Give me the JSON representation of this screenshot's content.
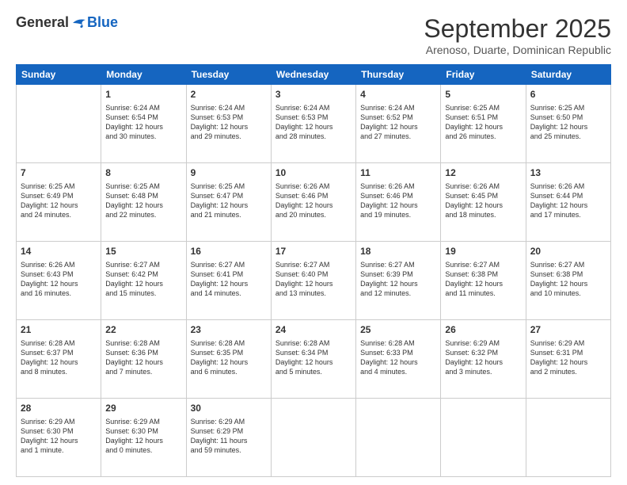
{
  "header": {
    "logo_general": "General",
    "logo_blue": "Blue",
    "month_title": "September 2025",
    "subtitle": "Arenoso, Duarte, Dominican Republic"
  },
  "days_of_week": [
    "Sunday",
    "Monday",
    "Tuesday",
    "Wednesday",
    "Thursday",
    "Friday",
    "Saturday"
  ],
  "weeks": [
    [
      {
        "day": "",
        "content": ""
      },
      {
        "day": "1",
        "content": "Sunrise: 6:24 AM\nSunset: 6:54 PM\nDaylight: 12 hours\nand 30 minutes."
      },
      {
        "day": "2",
        "content": "Sunrise: 6:24 AM\nSunset: 6:53 PM\nDaylight: 12 hours\nand 29 minutes."
      },
      {
        "day": "3",
        "content": "Sunrise: 6:24 AM\nSunset: 6:53 PM\nDaylight: 12 hours\nand 28 minutes."
      },
      {
        "day": "4",
        "content": "Sunrise: 6:24 AM\nSunset: 6:52 PM\nDaylight: 12 hours\nand 27 minutes."
      },
      {
        "day": "5",
        "content": "Sunrise: 6:25 AM\nSunset: 6:51 PM\nDaylight: 12 hours\nand 26 minutes."
      },
      {
        "day": "6",
        "content": "Sunrise: 6:25 AM\nSunset: 6:50 PM\nDaylight: 12 hours\nand 25 minutes."
      }
    ],
    [
      {
        "day": "7",
        "content": "Sunrise: 6:25 AM\nSunset: 6:49 PM\nDaylight: 12 hours\nand 24 minutes."
      },
      {
        "day": "8",
        "content": "Sunrise: 6:25 AM\nSunset: 6:48 PM\nDaylight: 12 hours\nand 22 minutes."
      },
      {
        "day": "9",
        "content": "Sunrise: 6:25 AM\nSunset: 6:47 PM\nDaylight: 12 hours\nand 21 minutes."
      },
      {
        "day": "10",
        "content": "Sunrise: 6:26 AM\nSunset: 6:46 PM\nDaylight: 12 hours\nand 20 minutes."
      },
      {
        "day": "11",
        "content": "Sunrise: 6:26 AM\nSunset: 6:46 PM\nDaylight: 12 hours\nand 19 minutes."
      },
      {
        "day": "12",
        "content": "Sunrise: 6:26 AM\nSunset: 6:45 PM\nDaylight: 12 hours\nand 18 minutes."
      },
      {
        "day": "13",
        "content": "Sunrise: 6:26 AM\nSunset: 6:44 PM\nDaylight: 12 hours\nand 17 minutes."
      }
    ],
    [
      {
        "day": "14",
        "content": "Sunrise: 6:26 AM\nSunset: 6:43 PM\nDaylight: 12 hours\nand 16 minutes."
      },
      {
        "day": "15",
        "content": "Sunrise: 6:27 AM\nSunset: 6:42 PM\nDaylight: 12 hours\nand 15 minutes."
      },
      {
        "day": "16",
        "content": "Sunrise: 6:27 AM\nSunset: 6:41 PM\nDaylight: 12 hours\nand 14 minutes."
      },
      {
        "day": "17",
        "content": "Sunrise: 6:27 AM\nSunset: 6:40 PM\nDaylight: 12 hours\nand 13 minutes."
      },
      {
        "day": "18",
        "content": "Sunrise: 6:27 AM\nSunset: 6:39 PM\nDaylight: 12 hours\nand 12 minutes."
      },
      {
        "day": "19",
        "content": "Sunrise: 6:27 AM\nSunset: 6:38 PM\nDaylight: 12 hours\nand 11 minutes."
      },
      {
        "day": "20",
        "content": "Sunrise: 6:27 AM\nSunset: 6:38 PM\nDaylight: 12 hours\nand 10 minutes."
      }
    ],
    [
      {
        "day": "21",
        "content": "Sunrise: 6:28 AM\nSunset: 6:37 PM\nDaylight: 12 hours\nand 8 minutes."
      },
      {
        "day": "22",
        "content": "Sunrise: 6:28 AM\nSunset: 6:36 PM\nDaylight: 12 hours\nand 7 minutes."
      },
      {
        "day": "23",
        "content": "Sunrise: 6:28 AM\nSunset: 6:35 PM\nDaylight: 12 hours\nand 6 minutes."
      },
      {
        "day": "24",
        "content": "Sunrise: 6:28 AM\nSunset: 6:34 PM\nDaylight: 12 hours\nand 5 minutes."
      },
      {
        "day": "25",
        "content": "Sunrise: 6:28 AM\nSunset: 6:33 PM\nDaylight: 12 hours\nand 4 minutes."
      },
      {
        "day": "26",
        "content": "Sunrise: 6:29 AM\nSunset: 6:32 PM\nDaylight: 12 hours\nand 3 minutes."
      },
      {
        "day": "27",
        "content": "Sunrise: 6:29 AM\nSunset: 6:31 PM\nDaylight: 12 hours\nand 2 minutes."
      }
    ],
    [
      {
        "day": "28",
        "content": "Sunrise: 6:29 AM\nSunset: 6:30 PM\nDaylight: 12 hours\nand 1 minute."
      },
      {
        "day": "29",
        "content": "Sunrise: 6:29 AM\nSunset: 6:30 PM\nDaylight: 12 hours\nand 0 minutes."
      },
      {
        "day": "30",
        "content": "Sunrise: 6:29 AM\nSunset: 6:29 PM\nDaylight: 11 hours\nand 59 minutes."
      },
      {
        "day": "",
        "content": ""
      },
      {
        "day": "",
        "content": ""
      },
      {
        "day": "",
        "content": ""
      },
      {
        "day": "",
        "content": ""
      }
    ]
  ]
}
